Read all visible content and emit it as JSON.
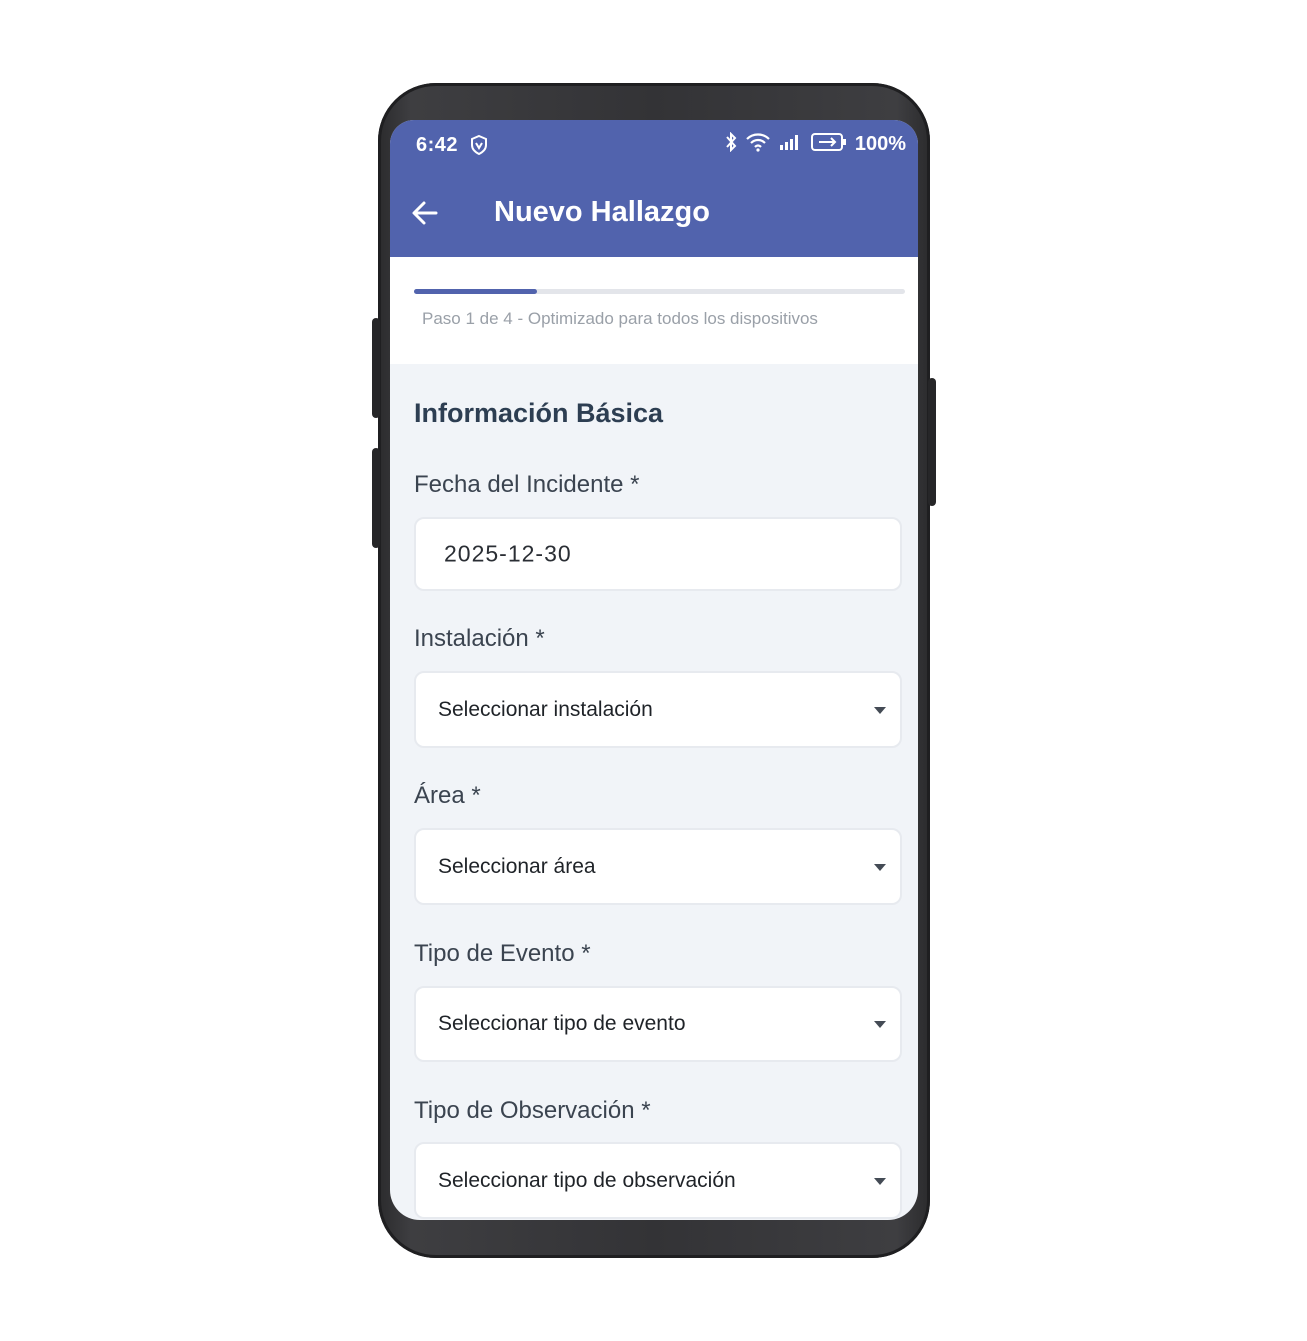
{
  "status_bar": {
    "time": "6:42",
    "battery": "100%",
    "icons": [
      "shield-icon",
      "bluetooth-icon",
      "wifi-icon",
      "signal-icon",
      "battery-icon"
    ]
  },
  "app_bar": {
    "title": "Nuevo Hallazgo",
    "back_icon": "arrow-left-icon",
    "color": "#5163ad"
  },
  "progress": {
    "text": "Paso 1 de 4 - Optimizado para todos los dispositivos",
    "current_step": 1,
    "total_steps": 4
  },
  "form": {
    "section_title": "Información Básica",
    "fecha": {
      "label": "Fecha del Incidente *",
      "value": "2025-12-30"
    },
    "instalacion": {
      "label": "Instalación *",
      "value": "Seleccionar instalación"
    },
    "area": {
      "label": "Área *",
      "value": "Seleccionar área"
    },
    "tipo_evento": {
      "label": "Tipo de Evento *",
      "value": "Seleccionar tipo de evento"
    },
    "tipo_observacion": {
      "label": "Tipo de Observación *",
      "value": "Seleccionar tipo de observación"
    }
  }
}
